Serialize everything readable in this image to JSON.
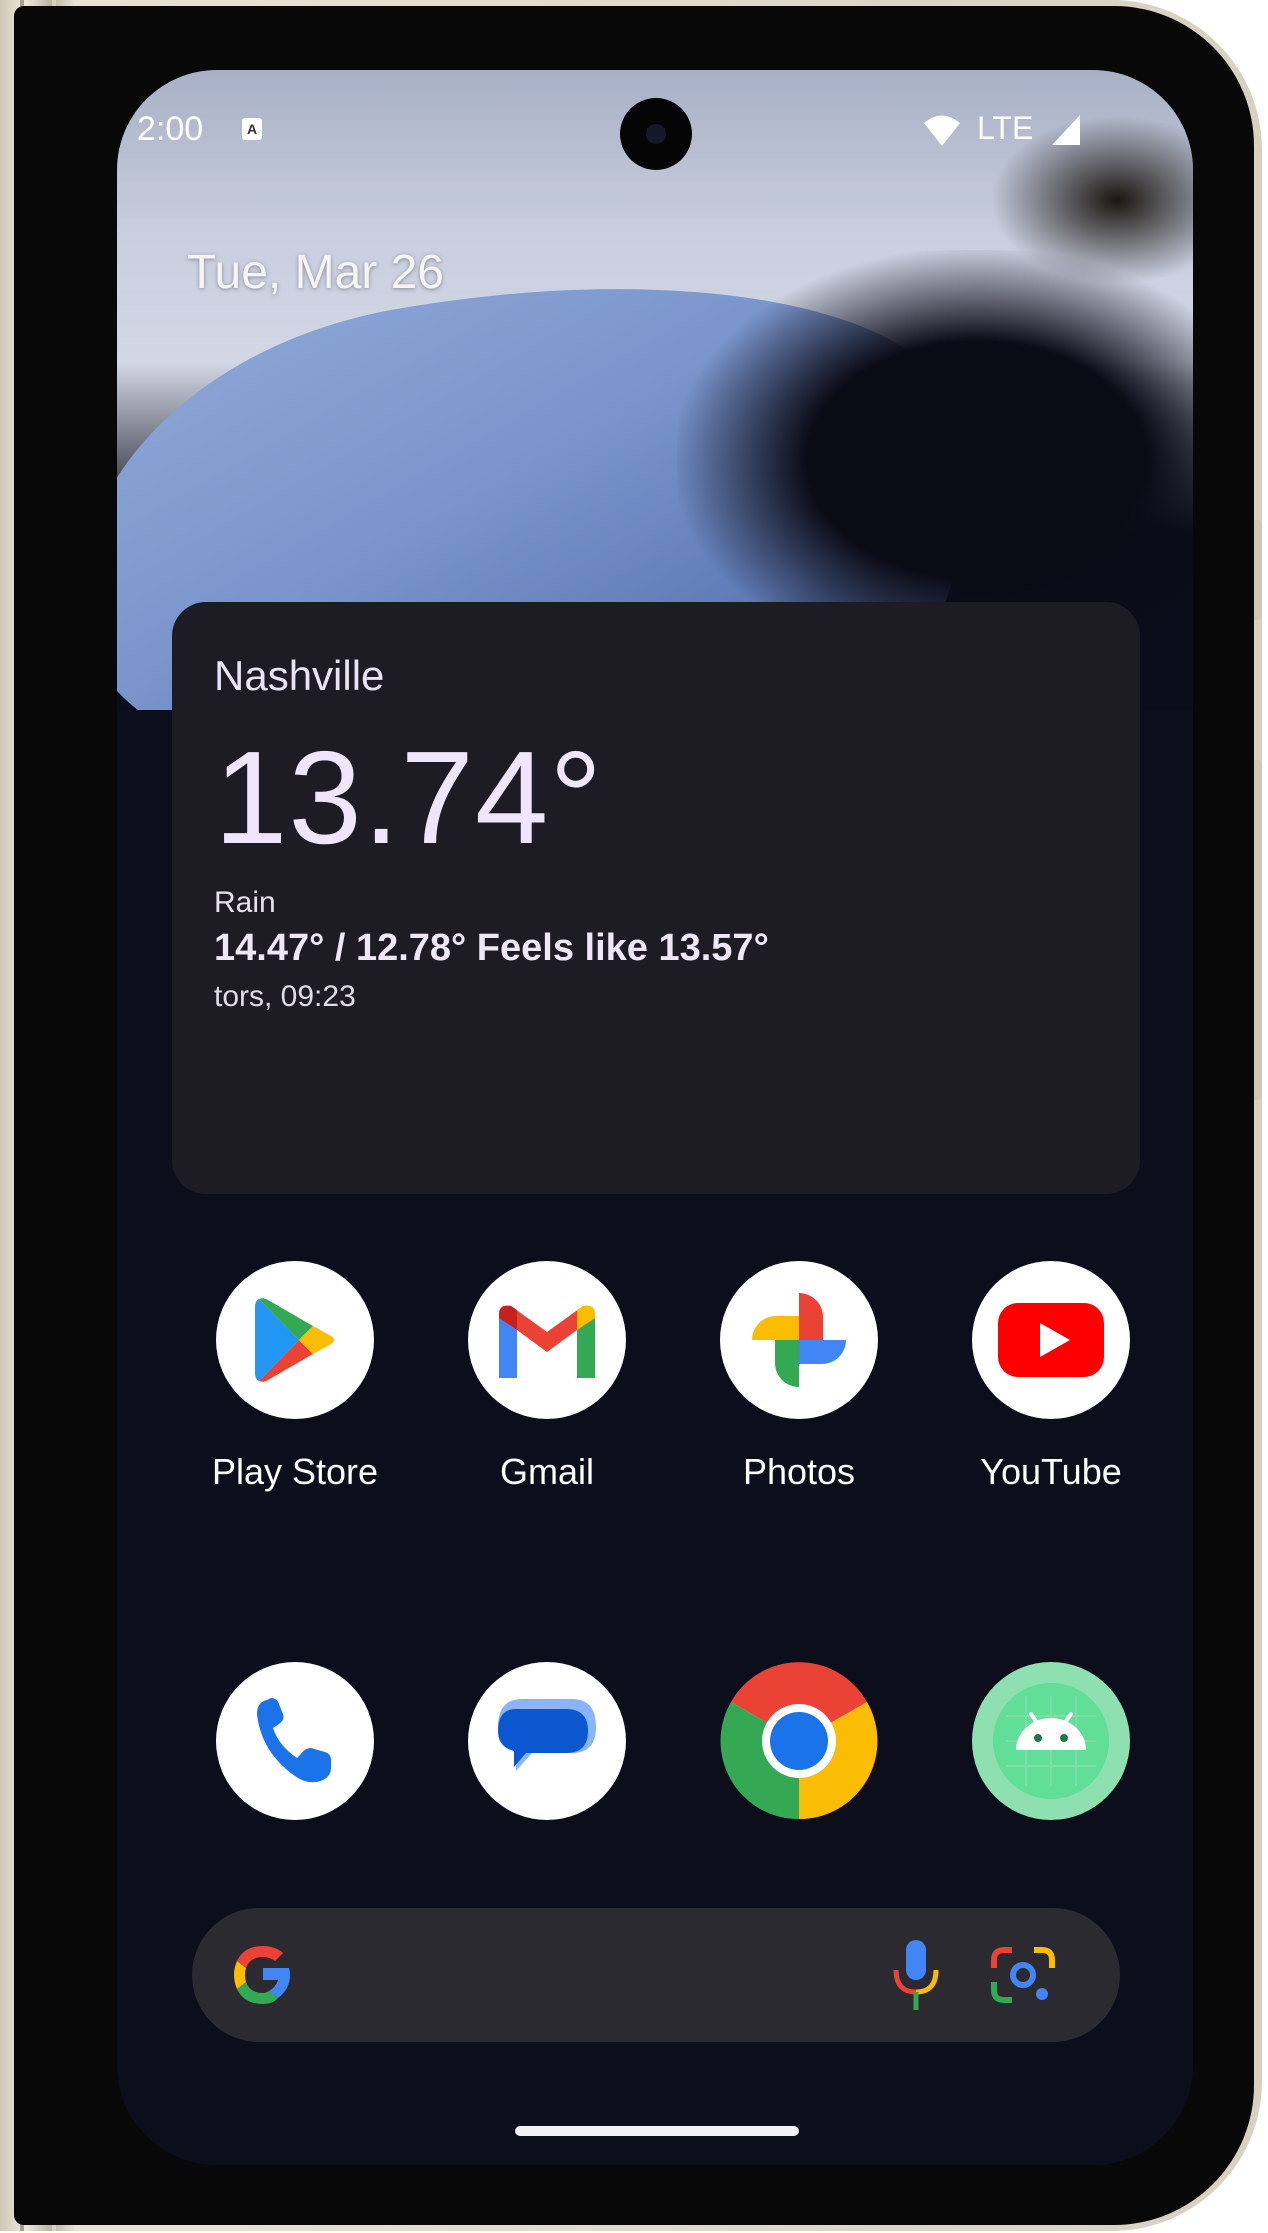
{
  "status_bar": {
    "time": "2:00",
    "notification_icon": "A",
    "network": "LTE"
  },
  "home": {
    "date": "Tue, Mar 26"
  },
  "weather": {
    "city": "Nashville",
    "temperature": "13.74°",
    "condition": "Rain",
    "range": "14.47° / 12.78° Feels like 13.57°",
    "updated": "tors, 09:23"
  },
  "apps_row1": [
    {
      "label": "Play Store",
      "icon": "play-store-icon"
    },
    {
      "label": "Gmail",
      "icon": "gmail-icon"
    },
    {
      "label": "Photos",
      "icon": "photos-icon"
    },
    {
      "label": "YouTube",
      "icon": "youtube-icon"
    }
  ],
  "dock": [
    {
      "icon": "phone-icon"
    },
    {
      "icon": "messages-icon"
    },
    {
      "icon": "chrome-icon"
    },
    {
      "icon": "android-icon"
    }
  ],
  "search": {
    "icons": [
      "google-g-icon",
      "mic-icon",
      "lens-icon"
    ]
  },
  "colors": {
    "widget_bg": "#1d1b24",
    "searchbar_bg": "#2b2a30",
    "frame": "#e8e2d2"
  }
}
